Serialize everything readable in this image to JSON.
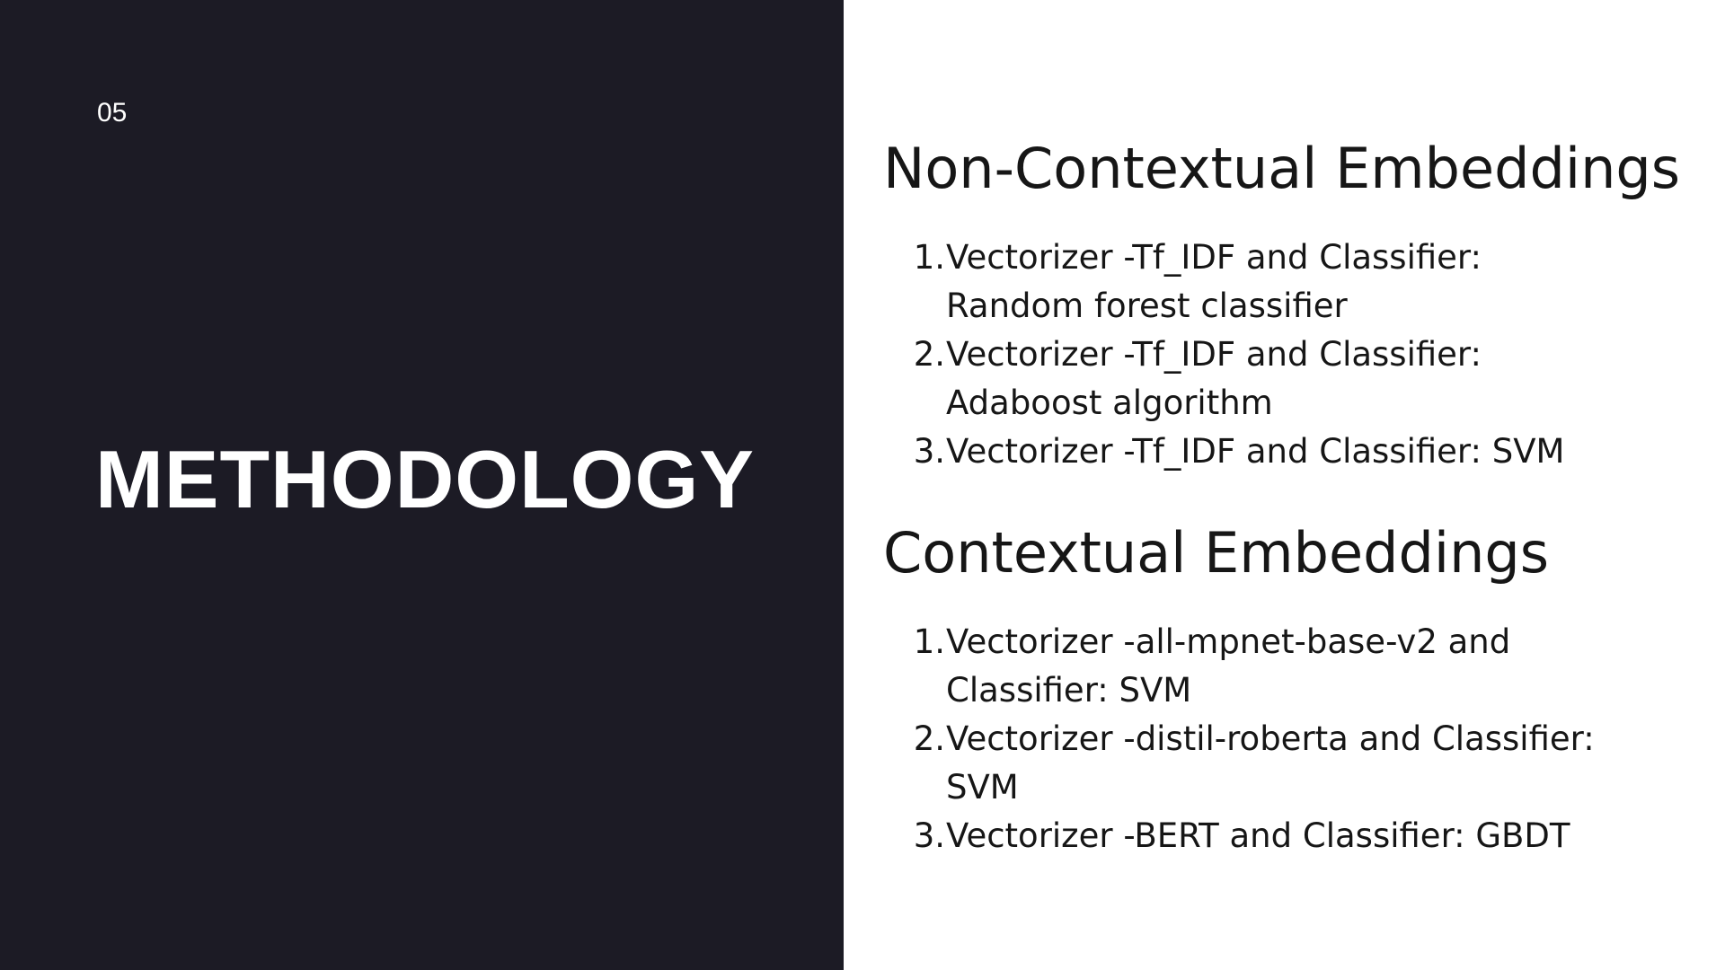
{
  "slide": {
    "number": "05",
    "title": "METHODOLOGY",
    "colors": {
      "left_background": "#1c1b25",
      "right_background": "#ffffff",
      "title_text": "#ffffff",
      "body_text": "#161616"
    }
  },
  "sections": [
    {
      "heading": "Non-Contextual Embeddings",
      "items": [
        {
          "num": "1.",
          "text": "Vectorizer -Tf_IDF and Classifier: Random forest classifier"
        },
        {
          "num": "2.",
          "text": "Vectorizer -Tf_IDF and Classifier: Adaboost algorithm"
        },
        {
          "num": "3.",
          "text": "Vectorizer -Tf_IDF and Classifier: SVM"
        }
      ]
    },
    {
      "heading": "Contextual Embeddings",
      "items": [
        {
          "num": "1.",
          "text": "Vectorizer -all-mpnet-base-v2 and Classifier: SVM"
        },
        {
          "num": "2.",
          "text": "Vectorizer -distil-roberta and Classifier: SVM"
        },
        {
          "num": "3.",
          "text": "Vectorizer -BERT and Classifier: GBDT"
        }
      ]
    }
  ]
}
